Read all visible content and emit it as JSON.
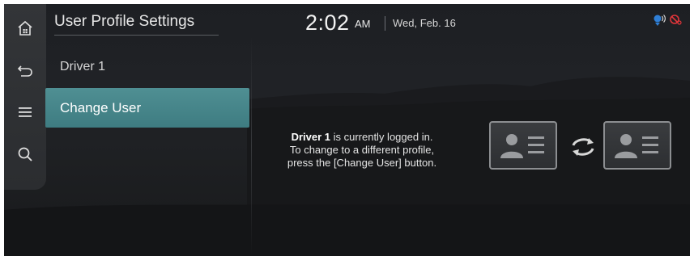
{
  "header": {
    "title": "User Profile Settings",
    "time": "2:02",
    "ampm": "AM",
    "date": "Wed, Feb. 16"
  },
  "rail": {
    "items": [
      {
        "icon": "home-icon"
      },
      {
        "icon": "back-icon"
      },
      {
        "icon": "menu-icon"
      },
      {
        "icon": "search-icon"
      }
    ]
  },
  "list": {
    "items": [
      {
        "label": "Driver 1",
        "selected": false
      },
      {
        "label": "Change User",
        "selected": true
      }
    ]
  },
  "message": {
    "driver": "Driver 1",
    "line1_rest": " is currently logged in.",
    "line2": "To change to a different profile,",
    "line3": "press the [Change User] button."
  },
  "status_icons": [
    "voice-recognition-icon",
    "mic-muted-icon"
  ],
  "colors": {
    "accent": "#4a8a8f",
    "background": "#1f2124",
    "rail": "#303235",
    "muted_status": "#e0353a",
    "voice_status": "#2f7fd6"
  }
}
